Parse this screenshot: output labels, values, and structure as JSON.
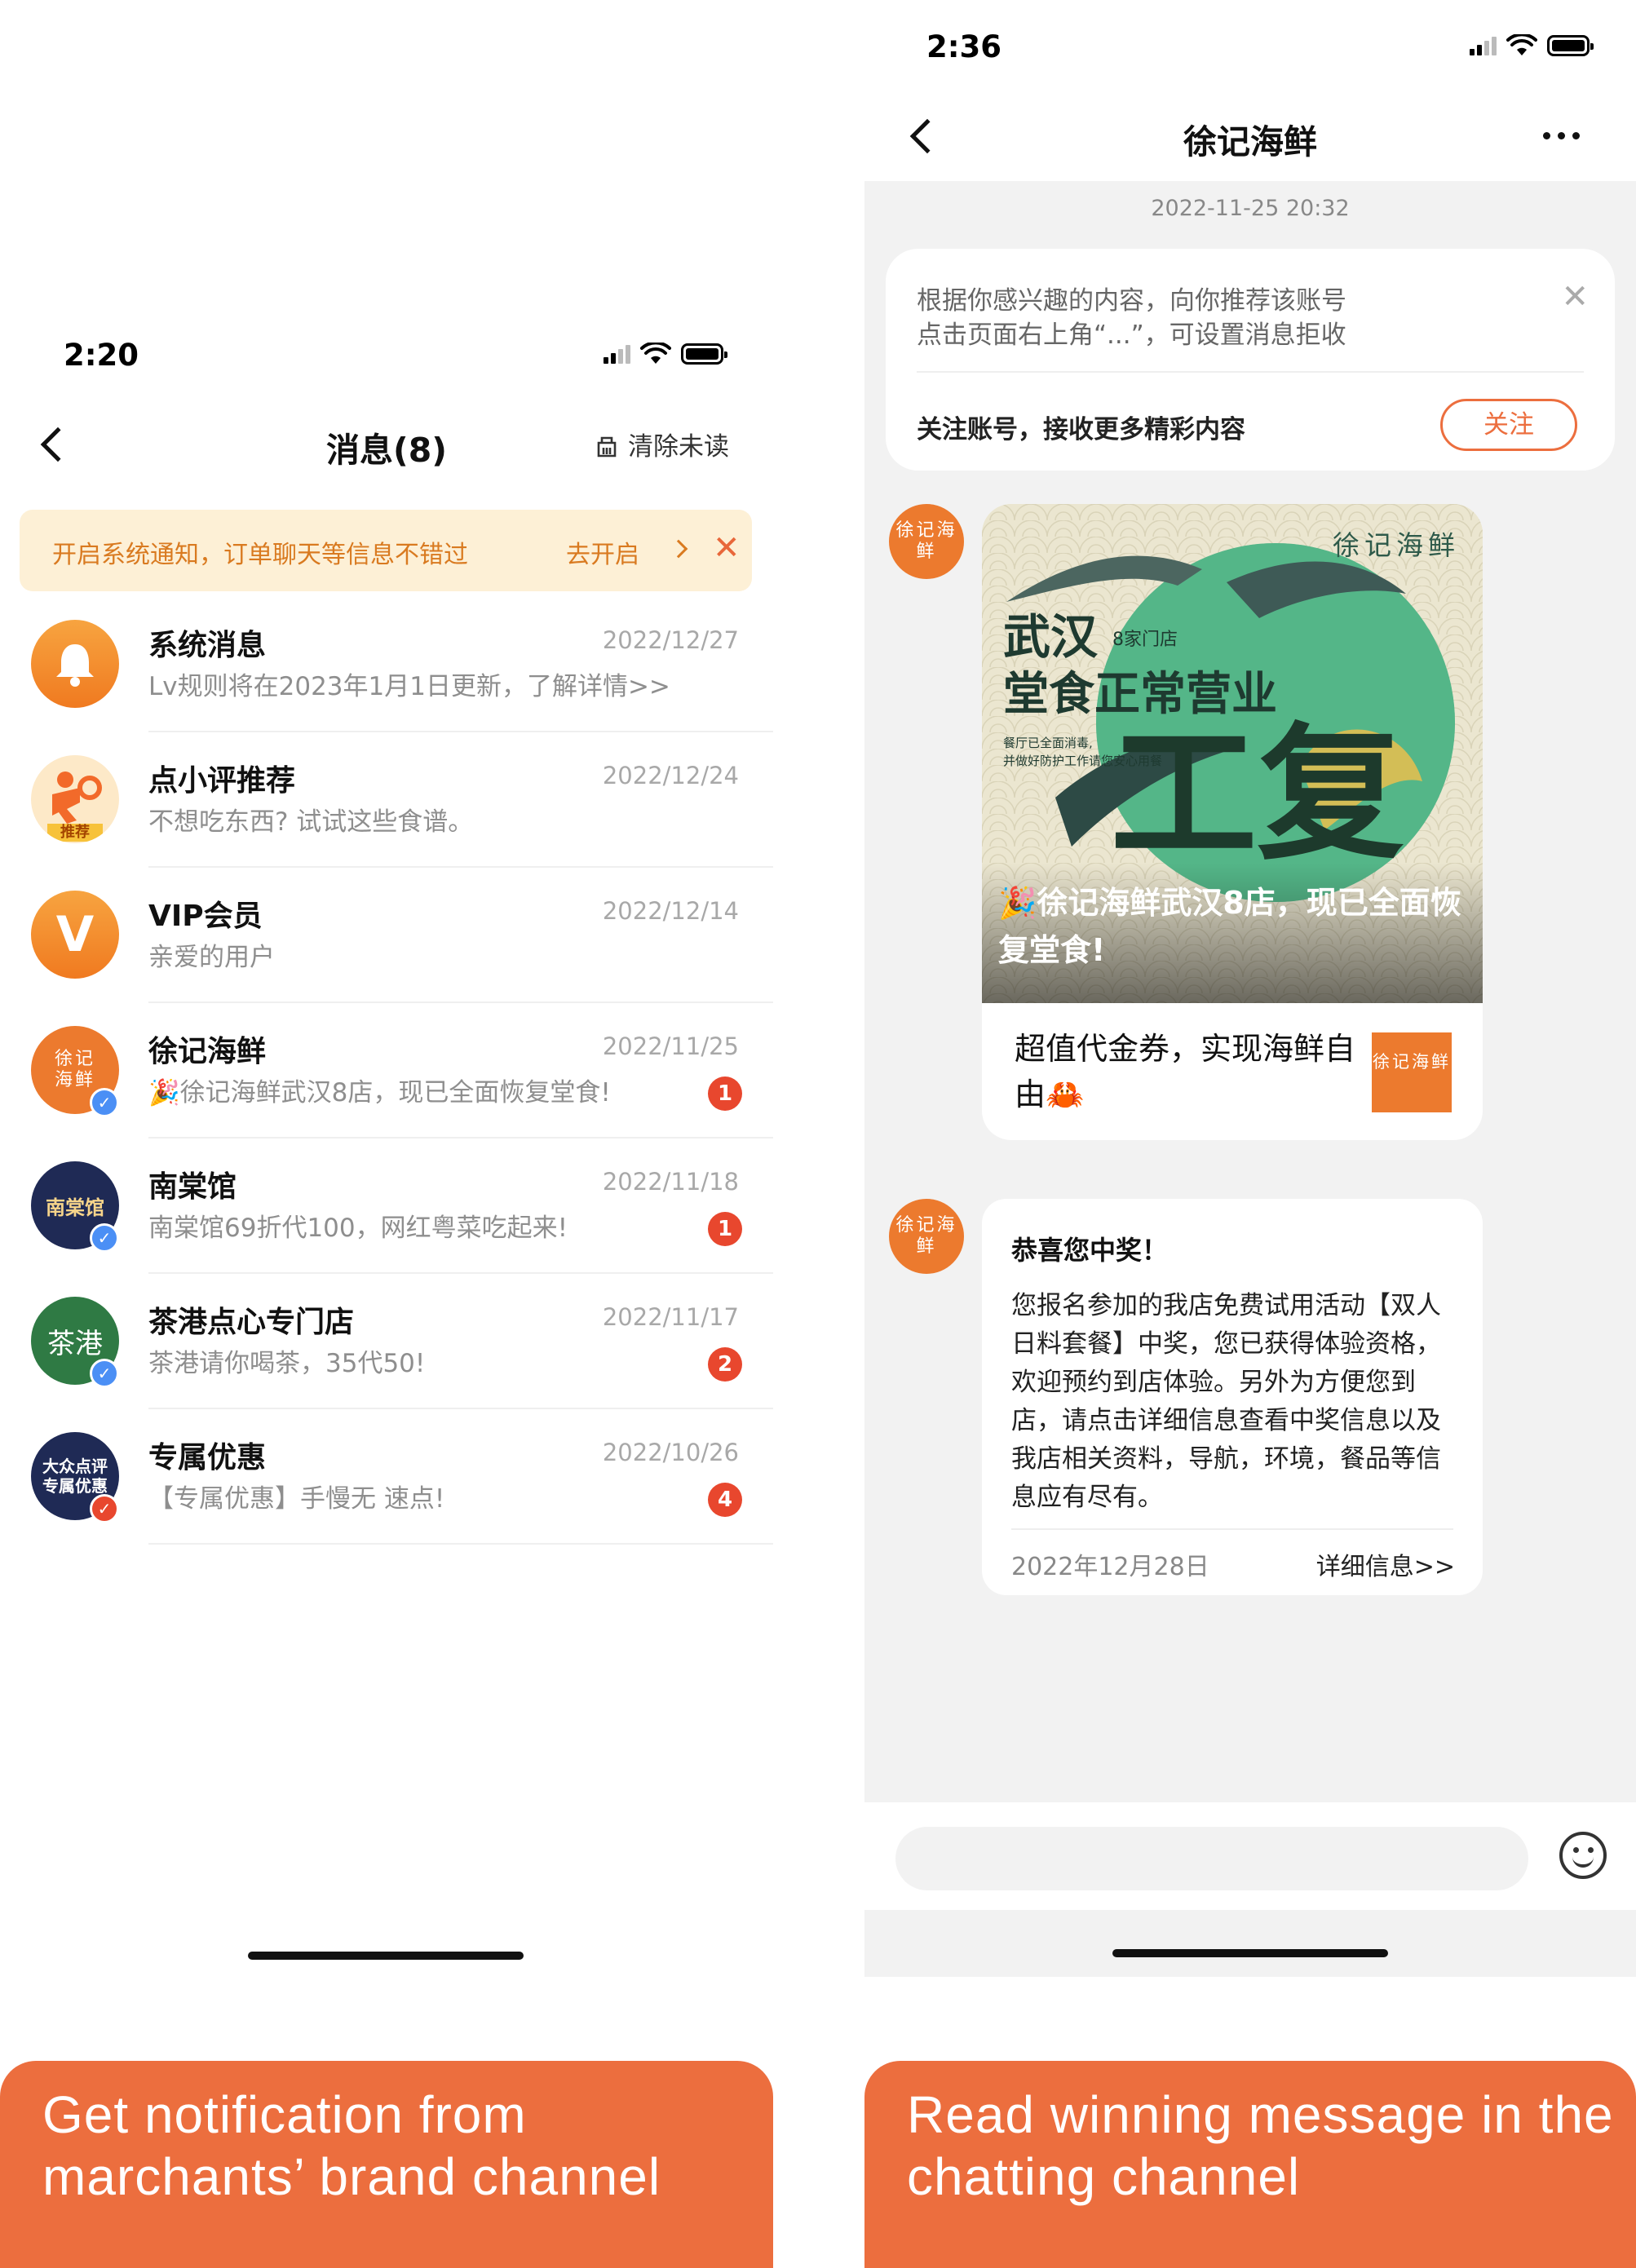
{
  "left": {
    "status_time": "2:20",
    "nav_title": "消息(8)",
    "clear_unread": "清除未读",
    "notify_bar": {
      "text": "开启系统通知，订单聊天等信息不错过",
      "action": "去开启"
    },
    "messages": [
      {
        "title": "系统消息",
        "date": "2022/12/27",
        "preview": "Lv规则将在2023年1月1日更新，了解详情>>",
        "badge": ""
      },
      {
        "title": "点小评推荐",
        "date": "2022/12/24",
        "preview": "不想吃东西? 试试这些食谱。",
        "badge": "",
        "avatar_text": "推荐"
      },
      {
        "title": "VIP会员",
        "date": "2022/12/14",
        "preview": "亲爱的用户",
        "badge": "",
        "avatar_text": "V"
      },
      {
        "title": "徐记海鲜",
        "date": "2022/11/25",
        "preview": "🎉徐记海鲜武汉8店，现已全面恢复堂食!",
        "badge": "1",
        "avatar_text": "徐记海鲜"
      },
      {
        "title": "南棠馆",
        "date": "2022/11/18",
        "preview": "南棠馆69折代100，网红粤菜吃起来!",
        "badge": "1",
        "avatar_text": "南棠馆"
      },
      {
        "title": "茶港点心专门店",
        "date": "2022/11/17",
        "preview": "茶港请你喝茶，35代50!",
        "badge": "2",
        "avatar_text": "茶港"
      },
      {
        "title": "专属优惠",
        "date": "2022/10/26",
        "preview": "【专属优惠】手慢无 速点!",
        "badge": "4",
        "avatar_text": "大众点评 专属优惠"
      }
    ],
    "caption": "Get notification from marchants’ brand channel"
  },
  "right": {
    "status_time": "2:36",
    "nav_title": "徐记海鲜",
    "timestamp": "2022-11-25 20:32",
    "rec_card": {
      "line1": "根据你感兴趣的内容，向你推荐该账号",
      "line2": "点击页面右上角“...”，可设置消息拒收",
      "line3": "关注账号，接收更多精彩内容",
      "follow": "关注"
    },
    "brand_avatar_text": "徐记海鲜",
    "promo": {
      "img_brand": "徐记海鲜",
      "img_city": "武汉",
      "img_stores": "8家门店",
      "img_headline": "堂食正常营业",
      "img_note1": "餐厅已全面消毒,",
      "img_note2": "并做好防护工作请您安心用餐",
      "img_big": "复工",
      "img_caption": "🎉徐记海鲜武汉8店，现已全面恢复堂食!",
      "title": "超值代金券，实现海鲜自由🦀",
      "logo_text": "徐记海鲜"
    },
    "win": {
      "title": "恭喜您中奖！",
      "body": "您报名参加的我店免费试用活动【双人日料套餐】中奖，您已获得体验资格，欢迎预约到店体验。另外为方便您到店，请点击详细信息查看中奖信息以及我店相关资料，导航，环境，餐品等信息应有尽有。",
      "date": "2022年12月28日",
      "link": "详细信息>>"
    },
    "caption": "Read winning message in the chatting channel"
  },
  "colors": {
    "accent": "#ec6e3e",
    "badge": "#e8472e",
    "notify_bg": "#fdf0d6",
    "chat_bg": "#f2f2f2"
  },
  "icons": [
    "signal-icon",
    "wifi-icon",
    "battery-icon",
    "back-icon",
    "clear-icon",
    "close-icon",
    "chevron-right-icon",
    "bell-icon",
    "verified-icon",
    "more-icon",
    "emoji-icon"
  ]
}
